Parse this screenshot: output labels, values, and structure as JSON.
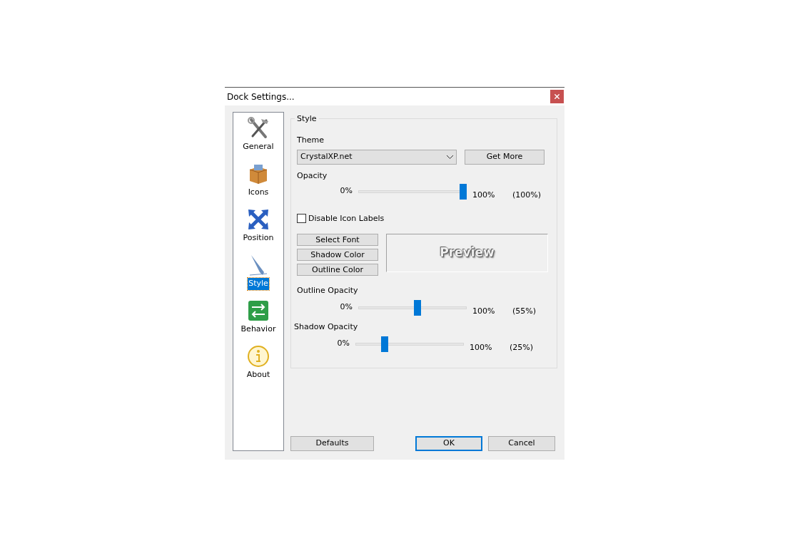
{
  "window": {
    "title": "Dock Settings..."
  },
  "sidebar": {
    "items": [
      {
        "label": "General",
        "kind": "tools",
        "selected": false
      },
      {
        "label": "Icons",
        "kind": "box",
        "selected": false
      },
      {
        "label": "Position",
        "kind": "arrows",
        "selected": false
      },
      {
        "label": "Style",
        "kind": "pen",
        "selected": true
      },
      {
        "label": "Behavior",
        "kind": "switch",
        "selected": false
      },
      {
        "label": "About",
        "kind": "info",
        "selected": false
      }
    ]
  },
  "style_group": {
    "legend": "Style",
    "theme_label": "Theme",
    "theme_value": "CrystalXP.net",
    "get_more": "Get More",
    "opacity": {
      "label": "Opacity",
      "min": "0%",
      "max": "100%",
      "reading": "(100%)",
      "level": 1.0
    },
    "checkbox": {
      "label": "Disable Icon Labels",
      "checked": false
    },
    "buttons": [
      "Select Font",
      "Shadow Color",
      "Outline Color"
    ],
    "preview": "Preview",
    "sliders": [
      {
        "label": "Outline Opacity",
        "min": "0%",
        "max": "100%",
        "reading": "(55%)",
        "level": 0.55
      },
      {
        "label": "Shadow Opacity",
        "min": "0%",
        "max": "100%",
        "reading": "(25%)",
        "level": 0.25
      }
    ]
  },
  "footer": [
    {
      "label": "Defaults",
      "default": false
    },
    {
      "label": "OK",
      "default": true
    },
    {
      "label": "Cancel",
      "default": false
    }
  ]
}
